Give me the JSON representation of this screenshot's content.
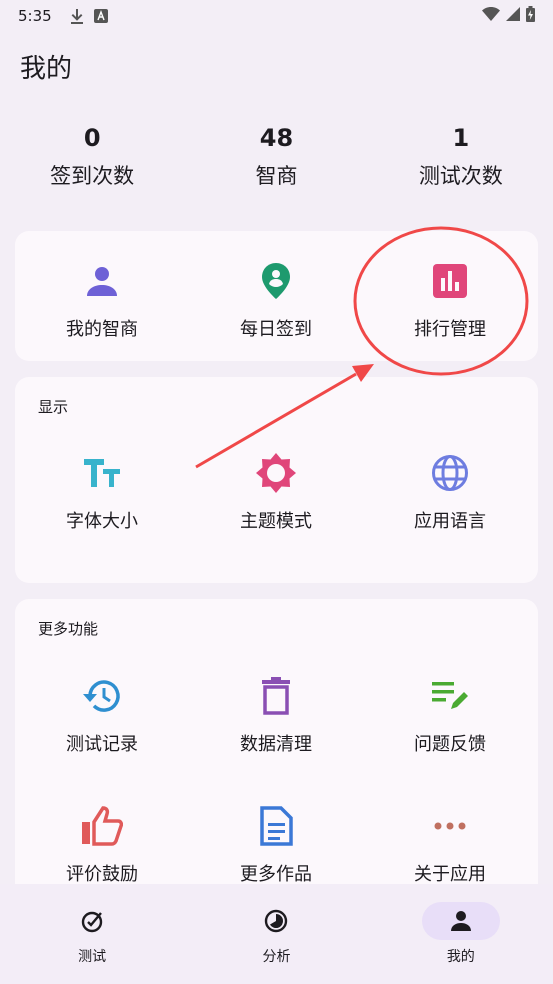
{
  "status_bar": {
    "time": "5:35"
  },
  "page_title": "我的",
  "stats": [
    {
      "value": "0",
      "label": "签到次数"
    },
    {
      "value": "48",
      "label": "智商"
    },
    {
      "value": "1",
      "label": "测试次数"
    }
  ],
  "top_card": {
    "items": [
      {
        "label": "我的智商",
        "icon": "person-icon",
        "color": "#6e61d6"
      },
      {
        "label": "每日签到",
        "icon": "location-person-icon",
        "color": "#1e9a6e"
      },
      {
        "label": "排行管理",
        "icon": "bar-chart-icon",
        "color": "#e0467a"
      }
    ]
  },
  "display_card": {
    "title": "显示",
    "items": [
      {
        "label": "字体大小",
        "icon": "text-size-icon",
        "color": "#38b3cc"
      },
      {
        "label": "主题模式",
        "icon": "brightness-icon",
        "color": "#e0467a"
      },
      {
        "label": "应用语言",
        "icon": "globe-icon",
        "color": "#6e7de0"
      }
    ]
  },
  "more_card": {
    "title": "更多功能",
    "items": [
      {
        "label": "测试记录",
        "icon": "history-icon",
        "color": "#2f8fd0"
      },
      {
        "label": "数据清理",
        "icon": "trash-icon",
        "color": "#8a4fb3"
      },
      {
        "label": "问题反馈",
        "icon": "edit-note-icon",
        "color": "#4aaa32"
      },
      {
        "label": "评价鼓励",
        "icon": "thumb-up-icon",
        "color": "#e05a5a"
      },
      {
        "label": "更多作品",
        "icon": "document-icon",
        "color": "#3b78d6"
      },
      {
        "label": "关于应用",
        "icon": "more-horiz-icon",
        "color": "#c07060"
      }
    ]
  },
  "bottom_nav": [
    {
      "label": "测试",
      "icon": "test-icon",
      "active": false
    },
    {
      "label": "分析",
      "icon": "analysis-icon",
      "active": false
    },
    {
      "label": "我的",
      "icon": "person-icon",
      "active": true
    }
  ],
  "annotation": {
    "color": "#f04848"
  }
}
